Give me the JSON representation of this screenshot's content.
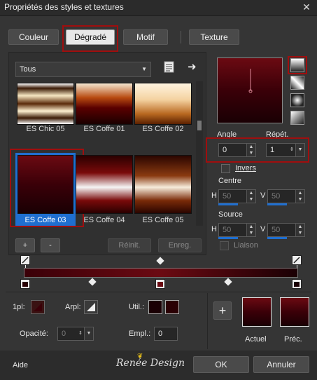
{
  "window": {
    "title": "Propriétés des styles et textures",
    "close_glyph": "✕"
  },
  "tabs": [
    {
      "label": "Couleur"
    },
    {
      "label": "Dégradé"
    },
    {
      "label": "Motif"
    },
    {
      "label": "Texture"
    }
  ],
  "gallery": {
    "filter_value": "Tous",
    "items": [
      {
        "label": "ES Chic 05"
      },
      {
        "label": "ES Coffe 01"
      },
      {
        "label": "ES Coffe 02"
      },
      {
        "label": "ES Coffe 03"
      },
      {
        "label": "ES Coffe 04"
      },
      {
        "label": "ES Coffe 05"
      }
    ],
    "selected": "ES Coffe 03",
    "add_label": "+",
    "remove_label": "-",
    "reset_label": "Réinit.",
    "save_label": "Enreg."
  },
  "gradient_settings": {
    "angle_label": "Angle",
    "angle_value": "0",
    "repeats_label": "Répét.",
    "repeats_value": "1",
    "invert_label": "Invers",
    "center_label": "Centre",
    "center_h_label": "H",
    "center_h_value": "50",
    "center_v_label": "V",
    "center_v_value": "50",
    "source_label": "Source",
    "source_h_label": "H",
    "source_h_value": "50",
    "source_v_label": "V",
    "source_v_value": "50",
    "link_label": "Liaison"
  },
  "bottom_controls": {
    "marker_label": "1pl:",
    "arpl_label": "Arpl:",
    "util_label": "Util.:",
    "opacity_label": "Opacité:",
    "opacity_value": "0",
    "empl_label": "Empl.:",
    "empl_value": "0",
    "plus_label": "+",
    "current_label": "Actuel",
    "previous_label": "Préc."
  },
  "footer": {
    "help_label": "Aide",
    "watermark": "Renée Design",
    "ok_label": "OK",
    "cancel_label": "Annuler"
  },
  "colors": {
    "dark_red": "#3a0008",
    "mid_red": "#6b0a0a",
    "accent_red": "#a00e0e",
    "select_blue": "#1f6fd0"
  }
}
